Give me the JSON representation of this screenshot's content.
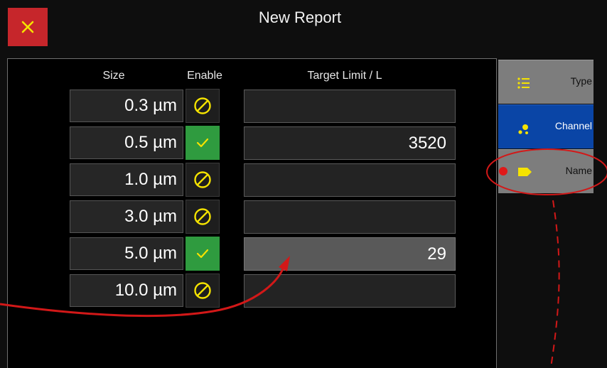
{
  "header": {
    "title": "New Report",
    "close_icon": "close-icon"
  },
  "columns": {
    "size": "Size",
    "enable": "Enable",
    "target": "Target Limit / L"
  },
  "rows": [
    {
      "size": "0.3 µm",
      "enabled": false,
      "target": ""
    },
    {
      "size": "0.5 µm",
      "enabled": true,
      "target": "3520"
    },
    {
      "size": "1.0 µm",
      "enabled": false,
      "target": ""
    },
    {
      "size": "3.0 µm",
      "enabled": false,
      "target": ""
    },
    {
      "size": "5.0 µm",
      "enabled": true,
      "target": "29"
    },
    {
      "size": "10.0 µm",
      "enabled": false,
      "target": ""
    }
  ],
  "sidebar": {
    "tabs": [
      {
        "label": "Type",
        "icon": "list-icon",
        "active": false
      },
      {
        "label": "Channel",
        "icon": "dots-icon",
        "active": true
      },
      {
        "label": "Name",
        "icon": "tag-icon",
        "active": false,
        "alert": true
      }
    ]
  },
  "colors": {
    "accent_yellow": "#f5e300",
    "close_red": "#c6262b",
    "enabled_green": "#2f9b3f",
    "active_tab_blue": "#0a45a6",
    "annotation_red": "#d21818"
  }
}
